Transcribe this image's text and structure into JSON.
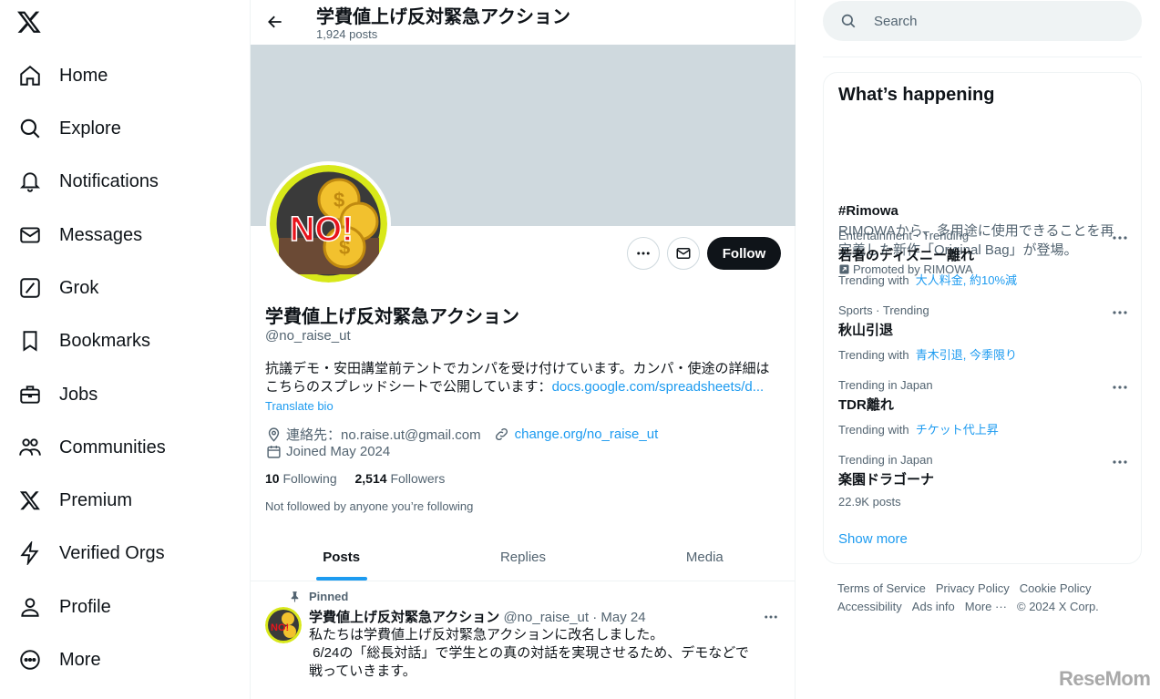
{
  "nav": {
    "items": [
      {
        "label": "Home",
        "icon": "home-icon"
      },
      {
        "label": "Explore",
        "icon": "search-icon"
      },
      {
        "label": "Notifications",
        "icon": "bell-icon"
      },
      {
        "label": "Messages",
        "icon": "mail-icon"
      },
      {
        "label": "Grok",
        "icon": "grok-icon"
      },
      {
        "label": "Bookmarks",
        "icon": "bookmark-icon"
      },
      {
        "label": "Jobs",
        "icon": "briefcase-icon"
      },
      {
        "label": "Communities",
        "icon": "communities-icon"
      },
      {
        "label": "Premium",
        "icon": "x-logo-icon"
      },
      {
        "label": "Verified Orgs",
        "icon": "lightning-icon"
      },
      {
        "label": "Profile",
        "icon": "person-icon"
      },
      {
        "label": "More",
        "icon": "more-circle-icon"
      }
    ]
  },
  "header": {
    "title": "学費値上げ反対緊急アクション",
    "post_count": "1,924 posts"
  },
  "profile": {
    "avatar_text": "NO!",
    "name": "学費値上げ反対緊急アクション",
    "handle": "@no_raise_ut",
    "follow_label": "Follow",
    "bio_line1": "抗議デモ・安田講堂前テントでカンパを受け付けています。カンパ・使途の詳細は",
    "bio_line2": "こちらのスプレッドシートで公開しています：",
    "bio_link": "docs.google.com/spreadsheets/d...",
    "translate": "Translate bio",
    "location": "連絡先：no.raise.ut@gmail.com",
    "website": "change.org/no_raise_ut",
    "joined": "Joined May 2024",
    "following_count": "10",
    "following_label": "Following",
    "followers_count": "2,514",
    "followers_label": "Followers",
    "not_followed": "Not followed by anyone you’re following"
  },
  "tabs": [
    "Posts",
    "Replies",
    "Media"
  ],
  "pinned_post": {
    "pinned_label": "Pinned",
    "author": "学費値上げ反対緊急アクション",
    "handle": "@no_raise_ut",
    "dot": "·",
    "date": "May 24",
    "line1": "私たちは学費値上げ反対緊急アクションに改名しました。",
    "line2": " 6/24の「総長対話」で学生との真の対話を実現させるため、デモなどで",
    "line3": "戦っていきます。"
  },
  "search": {
    "placeholder": "Search"
  },
  "trends": {
    "heading": "What’s happening",
    "promo": {
      "name": "#Rimowa",
      "text": "RIMOWAから、多用途に使用できることを再定義した新作「Original Bag」が登場。",
      "by": "Promoted by RIMOWA"
    },
    "items": [
      {
        "context": "Entertainment · Trending",
        "name": "若者のディズニー離れ",
        "with_label": "Trending with",
        "with_tags": "大人料金, 約10%減"
      },
      {
        "context": "Sports · Trending",
        "name": "秋山引退",
        "with_label": "Trending with",
        "with_tags": "青木引退, 今季限り"
      },
      {
        "context": "Trending in Japan",
        "name": "TDR離れ",
        "with_label": "Trending with",
        "with_tags": "チケット代上昇"
      },
      {
        "context": "Trending in Japan",
        "name": "楽園ドラゴーナ",
        "with_label": "22.9K posts",
        "with_tags": ""
      }
    ],
    "show_more": "Show more"
  },
  "footer": {
    "row1": [
      "Terms of Service",
      "Privacy Policy",
      "Cookie Policy"
    ],
    "row2": [
      "Accessibility",
      "Ads info",
      "More ···",
      "© 2024 X Corp."
    ]
  },
  "watermark": "ReseMom",
  "colors": {
    "accent": "#1d9bf0",
    "text": "#0f1419",
    "muted": "#536471",
    "banner": "#cfd9de"
  }
}
